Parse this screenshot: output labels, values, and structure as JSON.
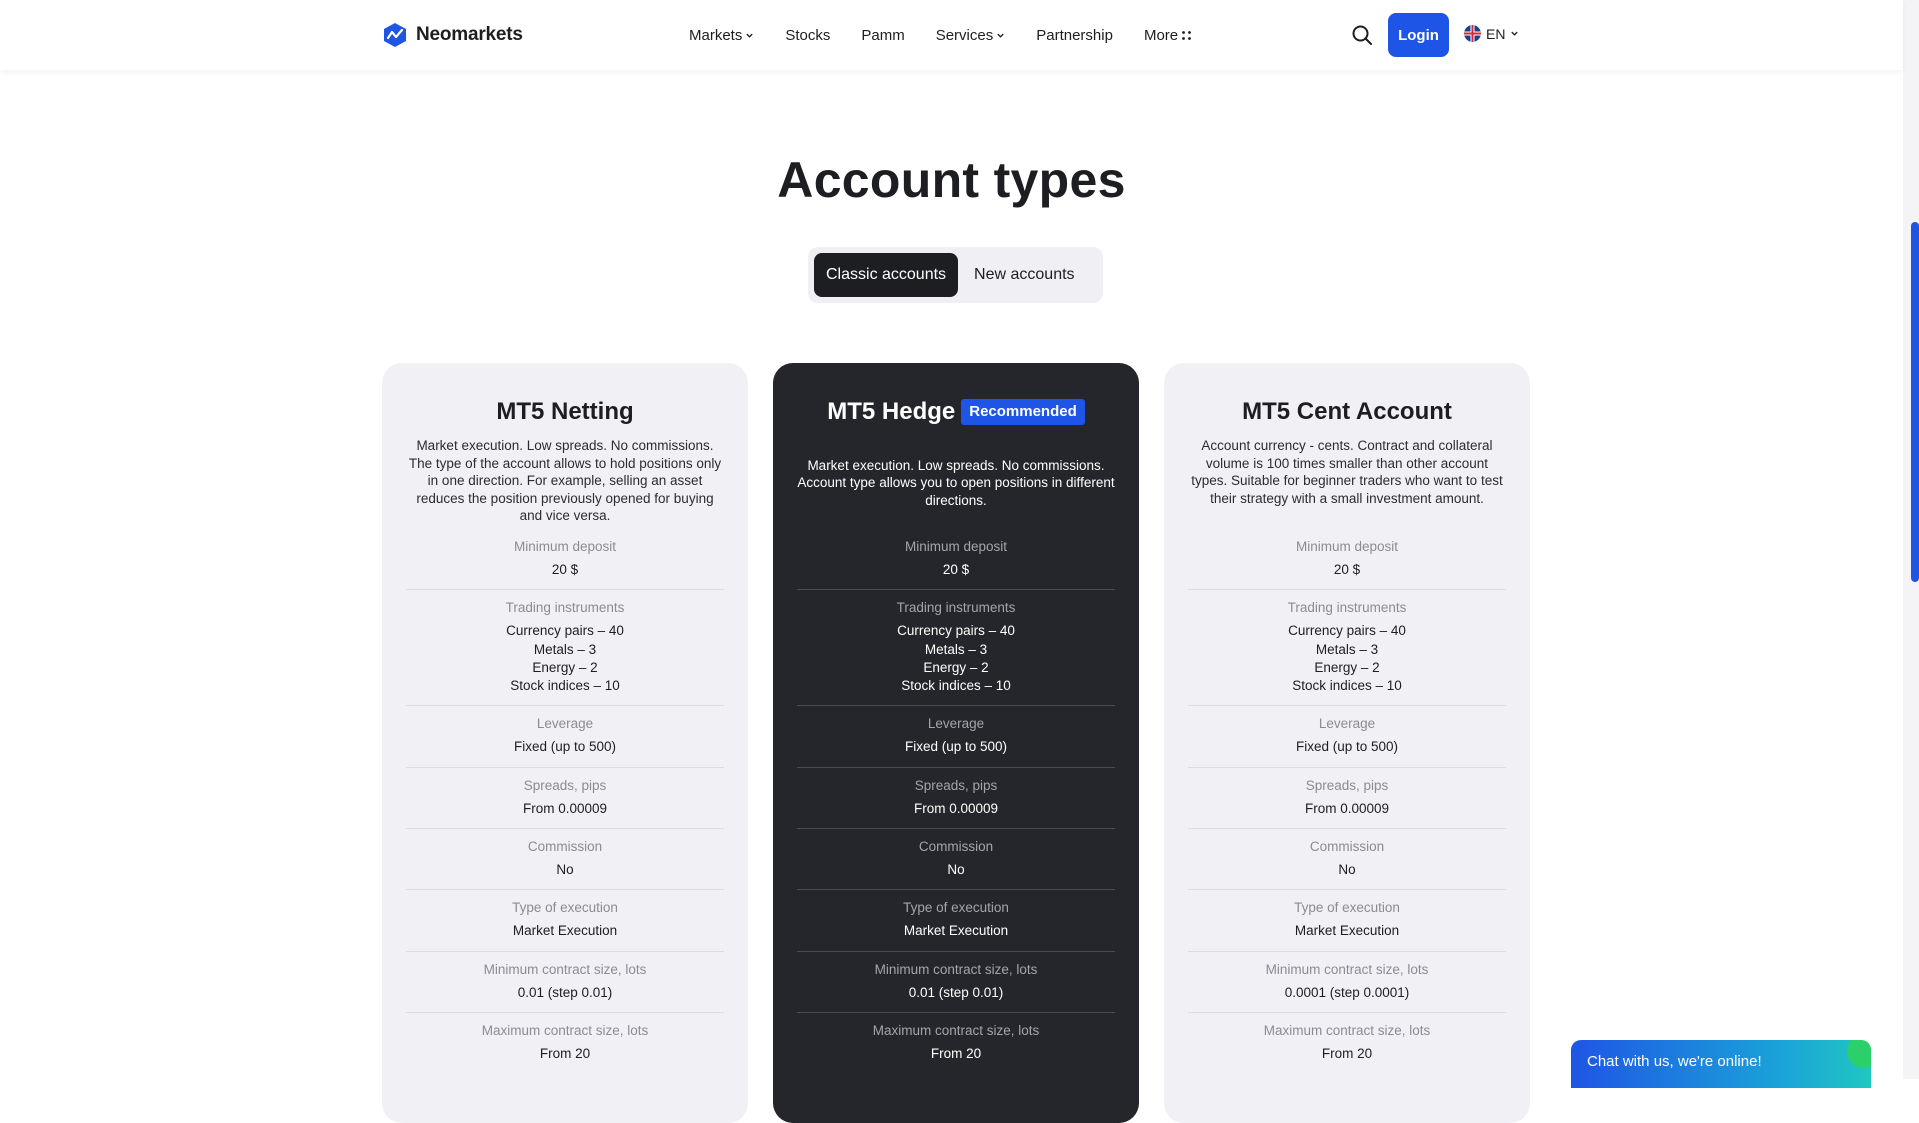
{
  "brand": {
    "name": "Neomarkets"
  },
  "nav": {
    "items": [
      {
        "label": "Markets",
        "dropdown": true
      },
      {
        "label": "Stocks",
        "dropdown": false
      },
      {
        "label": "Pamm",
        "dropdown": false
      },
      {
        "label": "Services",
        "dropdown": true
      },
      {
        "label": "Partnership",
        "dropdown": false
      },
      {
        "label": "More",
        "dropdown": false
      }
    ],
    "login_label": "Login",
    "language": "EN"
  },
  "page": {
    "title": "Account types",
    "tabs": [
      {
        "label": "Classic accounts",
        "active": true
      },
      {
        "label": "New accounts",
        "active": false
      }
    ]
  },
  "cards": [
    {
      "title": "MT5 Netting",
      "badge": "",
      "description": "Market execution. Low spreads. No commissions. The type of the account allows to hold positions only in one direction. For example, selling an asset reduces the position previously opened for buying and vice versa.",
      "rows": [
        {
          "label": "Minimum deposit",
          "value": "20 $"
        },
        {
          "label": "Trading instruments",
          "value": "Currency pairs – 40\nMetals – 3\nEnergy – 2\nStock indices – 10"
        },
        {
          "label": "Leverage",
          "value": "Fixed (up to 500)"
        },
        {
          "label": "Spreads, pips",
          "value": "From 0.00009"
        },
        {
          "label": "Commission",
          "value": "No"
        },
        {
          "label": "Type of execution",
          "value": "Market Execution"
        },
        {
          "label": "Minimum contract size, lots",
          "value": "0.01 (step 0.01)"
        },
        {
          "label": "Maximum contract size, lots",
          "value": "From 20"
        }
      ]
    },
    {
      "title": "MT5 Hedge",
      "badge": "Recommended",
      "description": "Market execution. Low spreads. No commissions. Account type allows you to open positions in different directions.",
      "rows": [
        {
          "label": "Minimum deposit",
          "value": "20 $"
        },
        {
          "label": "Trading instruments",
          "value": "Currency pairs – 40\nMetals – 3\nEnergy – 2\nStock indices – 10"
        },
        {
          "label": "Leverage",
          "value": "Fixed (up to 500)"
        },
        {
          "label": "Spreads, pips",
          "value": "From 0.00009"
        },
        {
          "label": "Commission",
          "value": "No"
        },
        {
          "label": "Type of execution",
          "value": "Market Execution"
        },
        {
          "label": "Minimum contract size, lots",
          "value": "0.01 (step 0.01)"
        },
        {
          "label": "Maximum contract size, lots",
          "value": "From 20"
        }
      ]
    },
    {
      "title": "MT5 Cent Account",
      "badge": "",
      "description": "Account currency - cents. Contract and collateral volume is 100 times smaller than other account types. Suitable for beginner traders who want to test their strategy with a small investment amount.",
      "rows": [
        {
          "label": "Minimum deposit",
          "value": "20 $"
        },
        {
          "label": "Trading instruments",
          "value": "Currency pairs – 40\nMetals – 3\nEnergy – 2\nStock indices – 10"
        },
        {
          "label": "Leverage",
          "value": "Fixed (up to 500)"
        },
        {
          "label": "Spreads, pips",
          "value": "From 0.00009"
        },
        {
          "label": "Commission",
          "value": "No"
        },
        {
          "label": "Type of execution",
          "value": "Market Execution"
        },
        {
          "label": "Minimum contract size, lots",
          "value": "0.0001 (step 0.0001)"
        },
        {
          "label": "Maximum contract size, lots",
          "value": "From 20"
        }
      ]
    }
  ],
  "chat": {
    "label": "Chat with us, we're online!"
  },
  "colors": {
    "accent": "#1f55e6",
    "dark": "#25262b",
    "card_light": "#f0f0f5"
  }
}
